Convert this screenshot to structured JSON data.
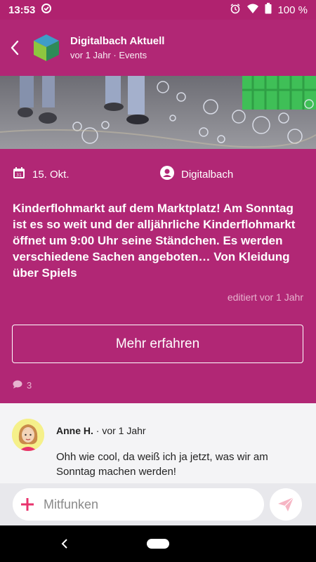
{
  "status_bar": {
    "time": "13:53",
    "battery": "100 %",
    "icons": [
      "data-saver-icon",
      "alarm-icon",
      "wifi-icon",
      "battery-icon"
    ]
  },
  "header": {
    "title": "Digitalbach Aktuell",
    "subtitle": "vor 1 Jahr · Events"
  },
  "post": {
    "date": "15. Okt.",
    "author": "Digitalbach",
    "text": "Kinderflohmarkt auf dem Marktplatz! Am Sonntag ist es so weit und der alljährliche Kinderflohmarkt öffnet um 9:00 Uhr seine Ständchen. Es werden verschiedene Sachen angeboten… Von Kleidung über Spiels",
    "edited": "editiert vor 1 Jahr",
    "more_label": "Mehr erfahren",
    "comment_count": "3"
  },
  "comment": {
    "author": "Anne H.",
    "time": "· vor 1 Jahr",
    "text": "Ohh wie cool, da weiß ich ja jetzt, was wir am Sonntag machen werden!"
  },
  "composer": {
    "placeholder": "Mitfunken"
  },
  "colors": {
    "primary": "#b12775",
    "status_bar": "#b0226f",
    "accent": "#e8336d",
    "comment_bg": "#f4f4f6"
  }
}
